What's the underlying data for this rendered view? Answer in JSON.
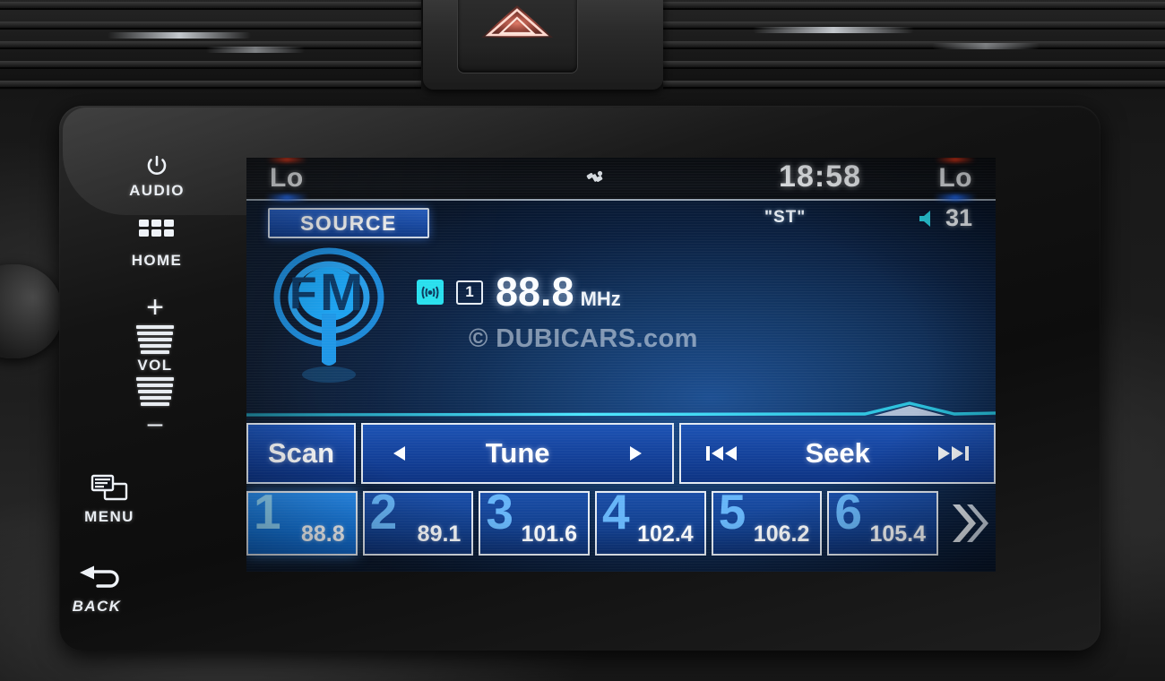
{
  "hardkeys": [
    {
      "id": "audio",
      "label": "AUDIO",
      "icon": "power-icon"
    },
    {
      "id": "home",
      "label": "HOME",
      "icon": "grid-icon"
    },
    {
      "id": "vol",
      "label": "VOL",
      "icon": "volume-slider-icon",
      "plus": "+",
      "minus": "–"
    },
    {
      "id": "menu",
      "label": "MENU",
      "icon": "menu-windows-icon"
    },
    {
      "id": "back",
      "label": "BACK",
      "icon": "back-arrow-icon"
    }
  ],
  "status_bar": {
    "climate_left": "Lo",
    "climate_right": "Lo",
    "clock": "18:58",
    "satellite_icon": "satellite-icon"
  },
  "sub_status": {
    "stereo": "ʺSTʺ",
    "volume_icon": "speaker-icon",
    "volume_value": "31"
  },
  "source": {
    "label": "SOURCE"
  },
  "band": {
    "logo_text": "FM",
    "logo_icon": "fm-antenna-icon"
  },
  "tuner": {
    "rds_icon": "rds-broadcast-icon",
    "preset_number": "1",
    "frequency": "88.8",
    "unit": "MHz"
  },
  "watermark": {
    "text": "© DUBICARS.com"
  },
  "controls": {
    "scan": "Scan",
    "tune": "Tune",
    "tune_prev_icon": "triangle-left-icon",
    "tune_next_icon": "triangle-right-icon",
    "seek": "Seek",
    "seek_prev_icon": "skip-back-icon",
    "seek_next_icon": "skip-forward-icon"
  },
  "presets": [
    {
      "number": "1",
      "frequency": "88.8",
      "active": true
    },
    {
      "number": "2",
      "frequency": "89.1",
      "active": false
    },
    {
      "number": "3",
      "frequency": "101.6",
      "active": false
    },
    {
      "number": "4",
      "frequency": "102.4",
      "active": false
    },
    {
      "number": "5",
      "frequency": "106.2",
      "active": false
    },
    {
      "number": "6",
      "frequency": "105.4",
      "active": false
    }
  ],
  "page_next": {
    "icon": "double-chevron-right-icon"
  },
  "hazard": {
    "icon": "hazard-triangle-icon",
    "color": "#ff4a3a"
  },
  "colors": {
    "screen_blue": "#1d4f91",
    "button_blue": "#14419a",
    "active_preset": "#1577dd",
    "accent_cyan": "#29e0ee",
    "text_white": "#fbfdff"
  }
}
